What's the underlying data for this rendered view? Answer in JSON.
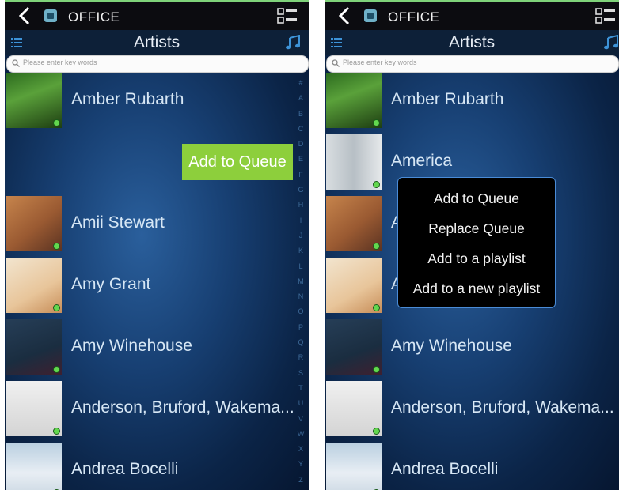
{
  "header": {
    "location": "OFFICE",
    "title": "Artists"
  },
  "search": {
    "placeholder": "Please enter key words"
  },
  "alphabet": [
    "#",
    "A",
    "B",
    "C",
    "D",
    "E",
    "F",
    "G",
    "H",
    "I",
    "J",
    "K",
    "L",
    "M",
    "N",
    "O",
    "P",
    "Q",
    "R",
    "S",
    "T",
    "U",
    "V",
    "W",
    "X",
    "Y",
    "Z"
  ],
  "left_screen": {
    "artists": [
      {
        "name": "Amber Rubarth",
        "art": "amber"
      },
      {
        "name": "",
        "art": ""
      },
      {
        "name": "Amii Stewart",
        "art": "amii"
      },
      {
        "name": "Amy Grant",
        "art": "grant"
      },
      {
        "name": "Amy Winehouse",
        "art": "wine"
      },
      {
        "name": "Anderson, Bruford, Wakema...",
        "art": "anderson"
      },
      {
        "name": "Andrea Bocelli",
        "art": "bocelli"
      }
    ],
    "swipe_action": "Add to Queue"
  },
  "right_screen": {
    "artists": [
      {
        "name": "Amber Rubarth",
        "art": "amber"
      },
      {
        "name": "America",
        "art": "america"
      },
      {
        "name": "A",
        "art": "amii"
      },
      {
        "name": "A",
        "art": "grant"
      },
      {
        "name": "Amy Winehouse",
        "art": "wine"
      },
      {
        "name": "Anderson, Bruford, Wakema...",
        "art": "anderson"
      },
      {
        "name": "Andrea Bocelli",
        "art": "bocelli"
      }
    ],
    "context_menu": [
      "Add to Queue",
      "Replace Queue",
      "Add to a playlist",
      "Add to a new playlist"
    ]
  },
  "colors": {
    "topbar": "#0c0c10",
    "titlebar": "#0d2038",
    "accent_green": "#8dcf3c",
    "popup_border": "#4a8bd6",
    "text_light": "#d7e7f5"
  },
  "icons": {
    "back": "back-arrow-icon",
    "app": "app-icon",
    "grid": "layout-toggle-icon",
    "list": "list-icon",
    "note": "music-note-icon",
    "search": "search-icon"
  }
}
